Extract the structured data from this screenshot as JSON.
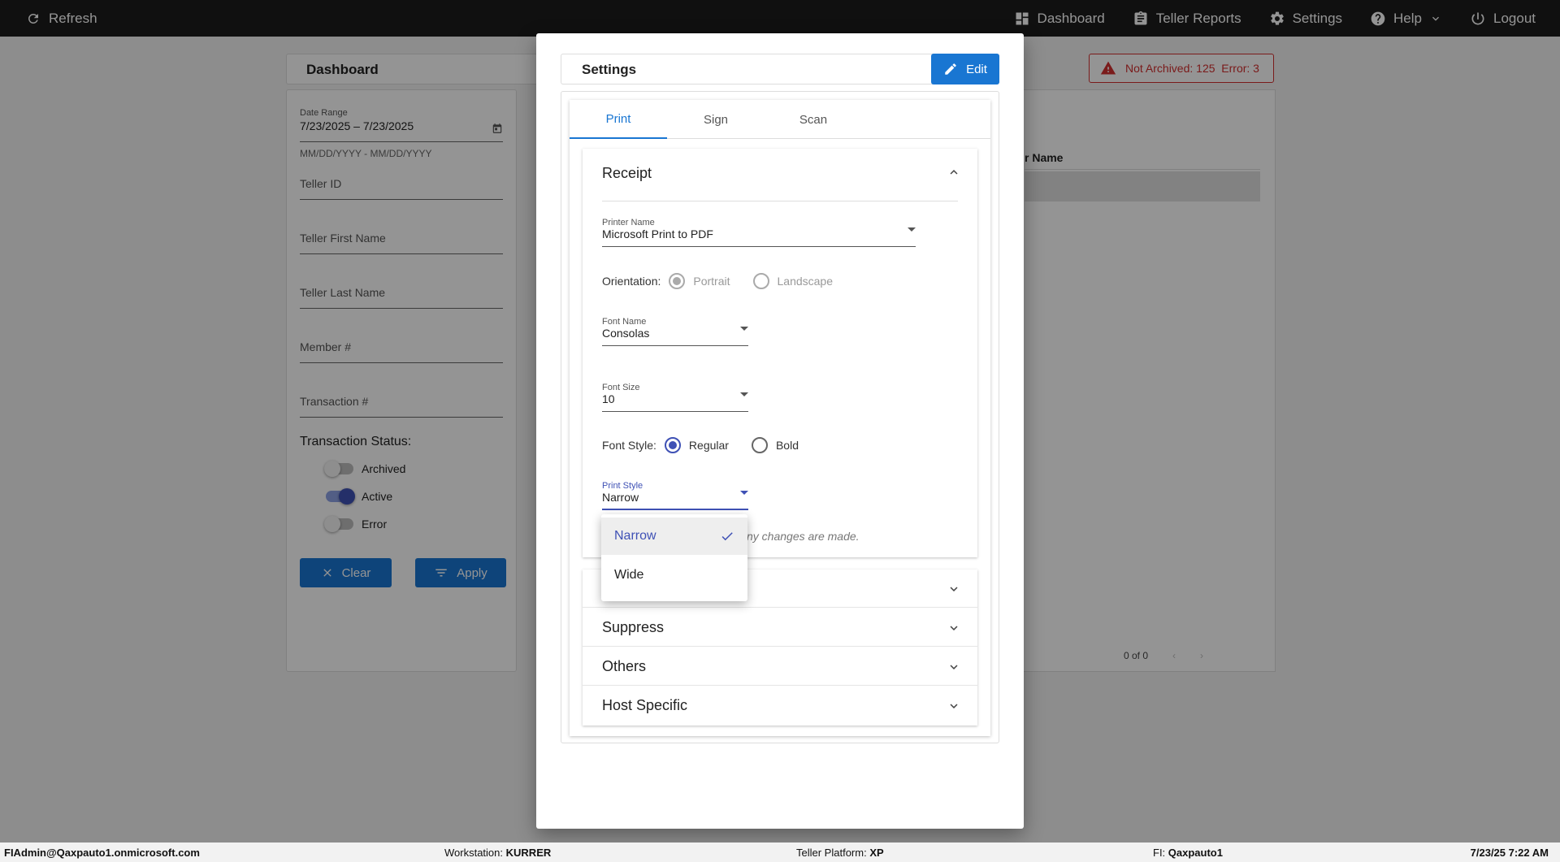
{
  "topbar": {
    "refresh": "Refresh",
    "nav": {
      "dashboard": "Dashboard",
      "teller_reports": "Teller Reports",
      "settings": "Settings",
      "help": "Help",
      "logout": "Logout"
    }
  },
  "dashboard": {
    "title": "Dashboard",
    "date_range": {
      "label": "Date Range",
      "value": "7/23/2025 – 7/23/2025",
      "hint": "MM/DD/YYYY - MM/DD/YYYY"
    },
    "fields": [
      "Teller ID",
      "Teller First Name",
      "Teller Last Name",
      "Member #",
      "Transaction #"
    ],
    "status_label": "Transaction Status:",
    "statuses": [
      {
        "label": "Archived",
        "on": false
      },
      {
        "label": "Active",
        "on": true
      },
      {
        "label": "Error",
        "on": false
      }
    ],
    "clear": "Clear",
    "apply": "Apply",
    "alert": "Not Archived: 125  Error: 3",
    "column_header": "r Name",
    "pager": "0 of 0"
  },
  "settings": {
    "title": "Settings",
    "edit": "Edit",
    "tabs": [
      "Print",
      "Sign",
      "Scan"
    ],
    "active_tab": "Print",
    "receipt": {
      "title": "Receipt",
      "printer_label": "Printer Name",
      "printer_value": "Microsoft Print to PDF",
      "orientation_label": "Orientation:",
      "orientation_options": [
        "Portrait",
        "Landscape"
      ],
      "font_name_label": "Font Name",
      "font_name_value": "Consolas",
      "font_size_label": "Font Size",
      "font_size_value": "10",
      "font_style_label": "Font Style:",
      "font_style_options": [
        "Regular",
        "Bold"
      ],
      "print_style_label": "Print Style",
      "print_style_value": "Narrow",
      "note_partial": "ny changes are made."
    },
    "sections": [
      "Suppress",
      "Others",
      "Host Specific"
    ],
    "dropdown": {
      "options": [
        "Narrow",
        "Wide"
      ],
      "selected": "Narrow"
    }
  },
  "statusbar": {
    "user": "FIAdmin@Qaxpauto1.onmicrosoft.com",
    "workstation_label": "Workstation:",
    "workstation": "KURRER",
    "platform_label": "Teller Platform:",
    "platform": "XP",
    "fi_label": "FI:",
    "fi": "Qaxpauto1",
    "datetime": "7/23/25 7:22 AM"
  },
  "colors": {
    "accent": "#1976d2",
    "indigo": "#3f51b5",
    "alert": "#d32f2f",
    "topbar": "#1c1c1c"
  }
}
